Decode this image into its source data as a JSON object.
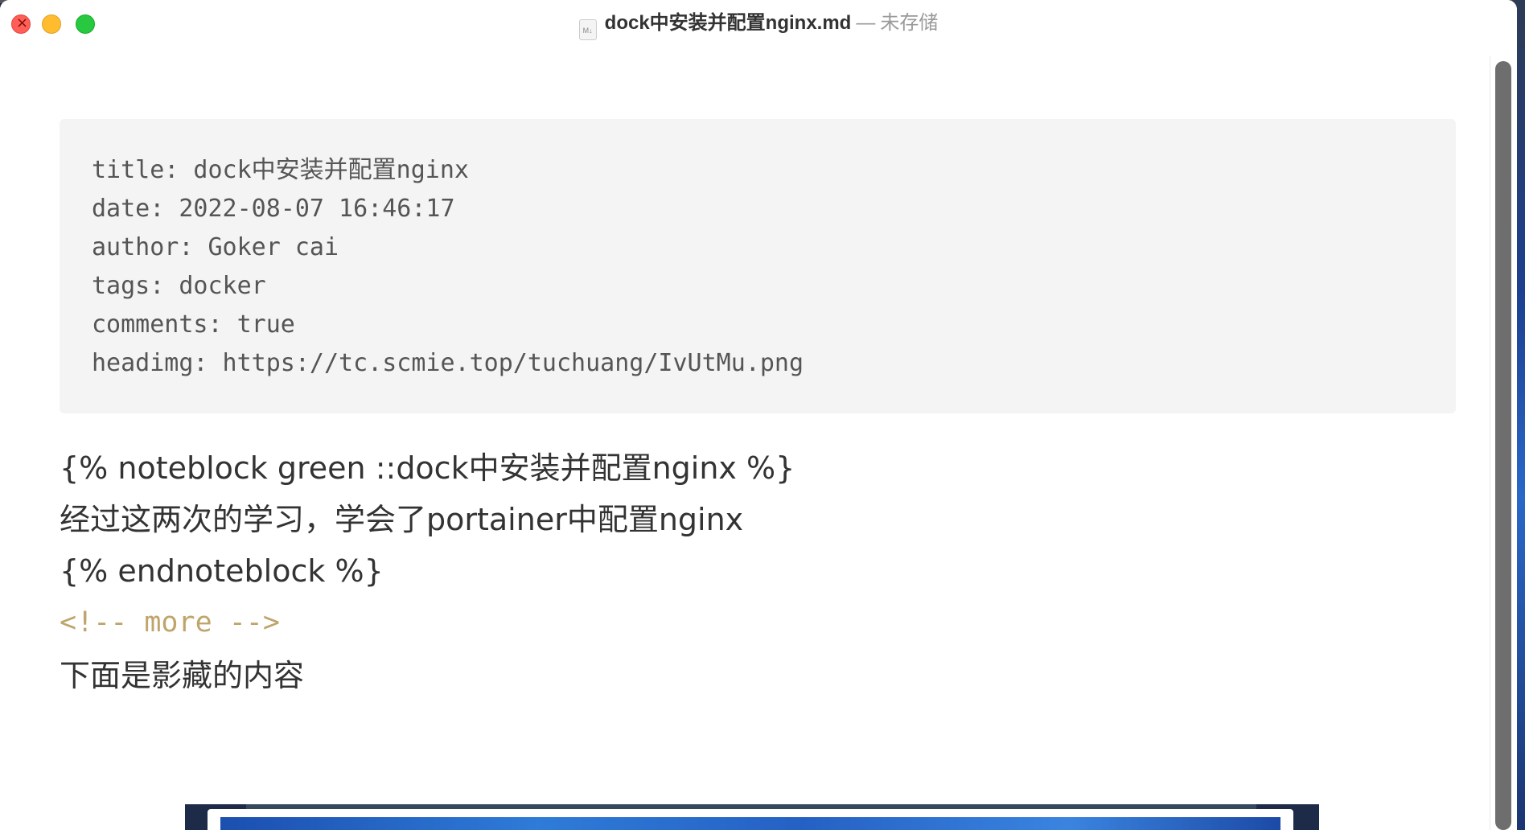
{
  "window": {
    "title": "dock中安装并配置nginx.md",
    "separator": "—",
    "status": "未存储",
    "file_icon_label": "M↓"
  },
  "front_matter": {
    "lines": [
      "title: dock中安装并配置nginx",
      "date: 2022-08-07 16:46:17",
      "author: Goker cai",
      "tags: docker",
      "comments: true",
      "headimg: https://tc.scmie.top/tuchuang/IvUtMu.png"
    ]
  },
  "body": {
    "line1": "{% noteblock green ::dock中安装并配置nginx %}",
    "line2": "经过这两次的学习，学会了portainer中配置nginx",
    "line3": "{% endnoteblock %}",
    "comment": "<!-- more -->",
    "line5": "下面是影藏的内容"
  },
  "colors": {
    "close": "#ff5f57",
    "minimize": "#febc2e",
    "maximize": "#28c840",
    "code_bg": "#f4f4f4",
    "comment_text": "#bfa56b"
  }
}
